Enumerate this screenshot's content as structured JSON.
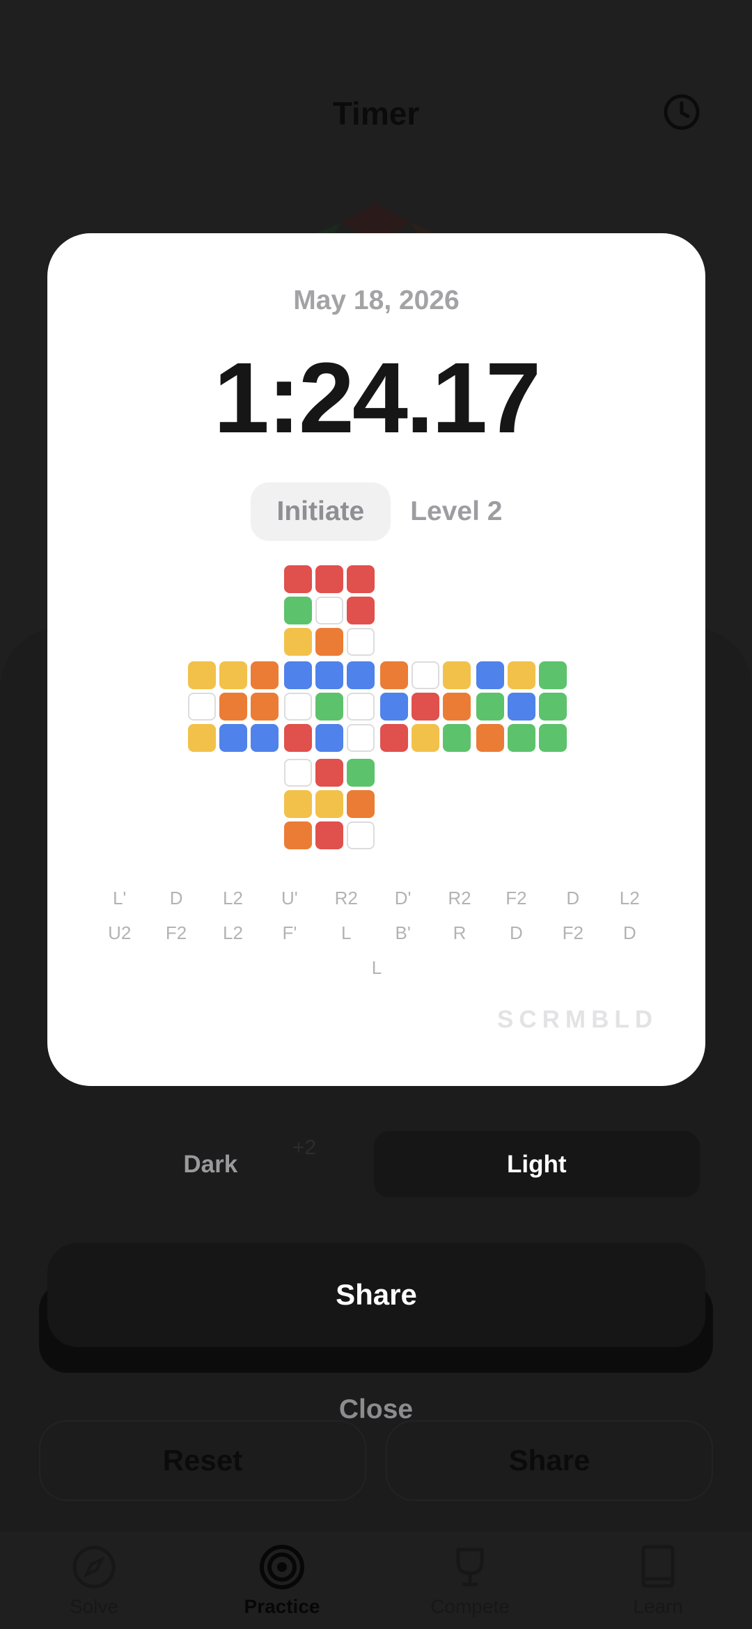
{
  "background": {
    "title": "Timer",
    "penalty_label": "+2",
    "reset_label": "Reset",
    "share_label": "Share",
    "nav": [
      {
        "label": "Solve",
        "icon": "compass-icon"
      },
      {
        "label": "Practice",
        "icon": "target-icon"
      },
      {
        "label": "Compete",
        "icon": "trophy-icon"
      },
      {
        "label": "Learn",
        "icon": "book-icon"
      }
    ]
  },
  "modal": {
    "date": "May 18, 2026",
    "time": "1:24.17",
    "rank_chip": "Initiate",
    "level": "Level 2",
    "scramble_rows": [
      [
        "L'",
        "D",
        "L2",
        "U'",
        "R2",
        "D'",
        "R2",
        "F2",
        "D",
        "L2"
      ],
      [
        "U2",
        "F2",
        "L2",
        "F'",
        "L",
        "B'",
        "R",
        "D",
        "F2",
        "D"
      ],
      [
        "L"
      ]
    ],
    "brand": "SCRMBLD",
    "cube_net": {
      "colors": {
        "R": "#e0504c",
        "G": "#5cc26c",
        "B": "#4f82ea",
        "Y": "#f2c14a",
        "O": "#eb7c35",
        "W": "#ffffff"
      },
      "up": [
        "RRR",
        "GWR",
        "YOW"
      ],
      "left": [
        "YYO",
        "WOO",
        "YBB"
      ],
      "front": [
        "BBB",
        "WGW",
        "RBW"
      ],
      "right": [
        "OWY",
        "BRO",
        "RYG"
      ],
      "back": [
        "BYG",
        "GBG",
        "OGG"
      ],
      "down": [
        "WRG",
        "YYO",
        "ORW"
      ]
    }
  },
  "theme": {
    "dark_label": "Dark",
    "light_label": "Light",
    "selected": "Light"
  },
  "actions": {
    "share_label": "Share",
    "close_label": "Close"
  }
}
